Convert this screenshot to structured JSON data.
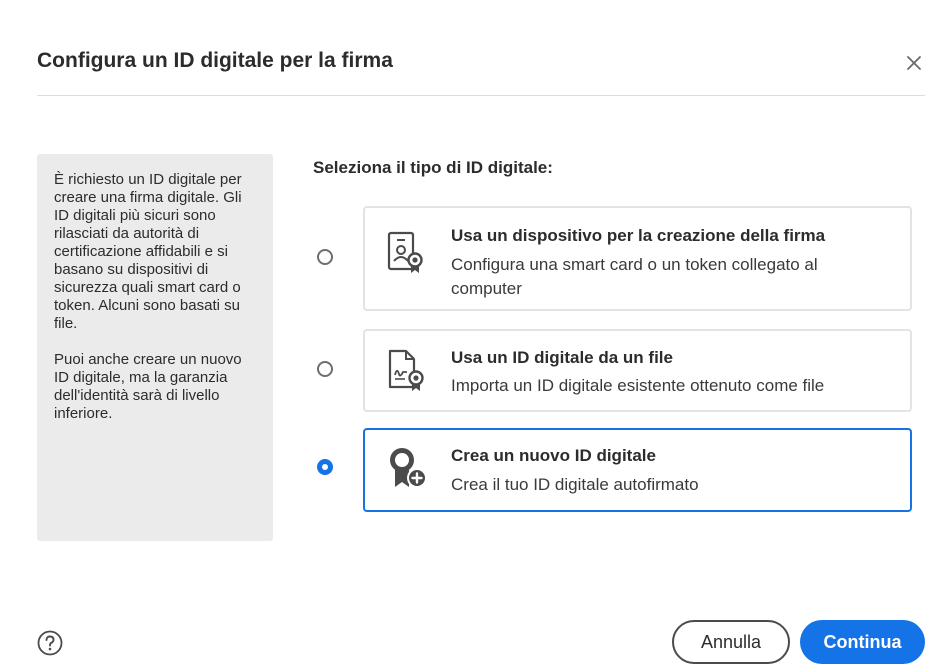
{
  "dialog": {
    "title": "Configura un ID digitale per la firma",
    "close_icon": "close-icon",
    "help_icon": "help-icon"
  },
  "info": {
    "paragraph_1": "È richiesto un ID digitale per creare una firma digitale. Gli ID digitali più sicuri sono rilasciati da autorità di certificazione affidabili e si basano su dispositivi di sicurezza quali smart card o token. Alcuni sono basati su file.",
    "paragraph_2": "Puoi anche creare un nuovo ID digitale, ma la garanzia dell'identità sarà di livello inferiore."
  },
  "selection": {
    "label": "Seleziona il tipo di ID digitale:",
    "selected_index": 2,
    "options": [
      {
        "title": "Usa un dispositivo per la creazione della firma",
        "description": "Configura una smart card o un token collegato al computer",
        "icon": "smart-card-device-icon"
      },
      {
        "title": "Usa un ID digitale da un file",
        "description": "Importa un ID digitale esistente ottenuto come file",
        "icon": "certificate-file-icon"
      },
      {
        "title": "Crea un nuovo ID digitale",
        "description": "Crea il tuo ID digitale autofirmato",
        "icon": "new-badge-add-icon"
      }
    ]
  },
  "footer": {
    "cancel_label": "Annulla",
    "continue_label": "Continua"
  },
  "colors": {
    "accent": "#1473e6",
    "panel_background": "#ebebeb",
    "card_border": "#e3e3e3",
    "text": "#2c2c2c"
  }
}
